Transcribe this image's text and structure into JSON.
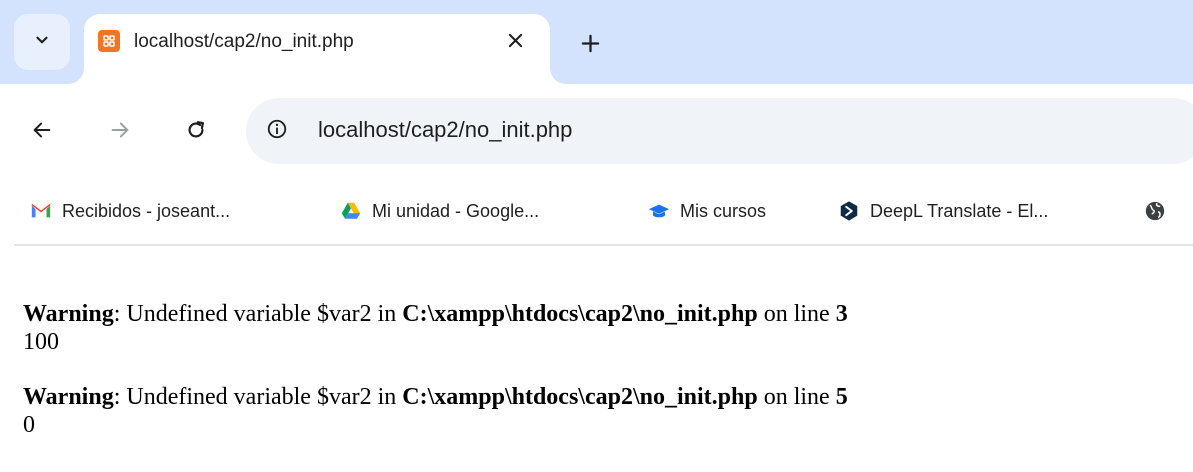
{
  "browser": {
    "tab": {
      "title": "localhost/cap2/no_init.php",
      "favicon": "xampp-icon"
    },
    "address_bar": {
      "url": "localhost/cap2/no_init.php"
    },
    "bookmarks": [
      {
        "label": "Recibidos - joseant...",
        "icon": "gmail-icon"
      },
      {
        "label": "Mi unidad - Google...",
        "icon": "google-drive-icon"
      },
      {
        "label": "Mis cursos",
        "icon": "graduation-cap-icon"
      },
      {
        "label": "DeepL Translate - El...",
        "icon": "deepl-icon"
      },
      {
        "label": "",
        "icon": "globe-icon"
      }
    ]
  },
  "page": {
    "messages": [
      {
        "label": "Warning",
        "text_before_path": ": Undefined variable $var2 in ",
        "path": "C:\\xampp\\htdocs\\cap2\\no_init.php",
        "text_before_line": " on line ",
        "line": "3",
        "output": "100"
      },
      {
        "label": "Warning",
        "text_before_path": ": Undefined variable $var2 in ",
        "path": "C:\\xampp\\htdocs\\cap2\\no_init.php",
        "text_before_line": " on line ",
        "line": "5",
        "output": "0"
      }
    ]
  },
  "colors": {
    "tabstrip_bg": "#d3e3fd",
    "omnibox_bg": "#f0f4f9",
    "favicon_orange": "#f37524"
  }
}
